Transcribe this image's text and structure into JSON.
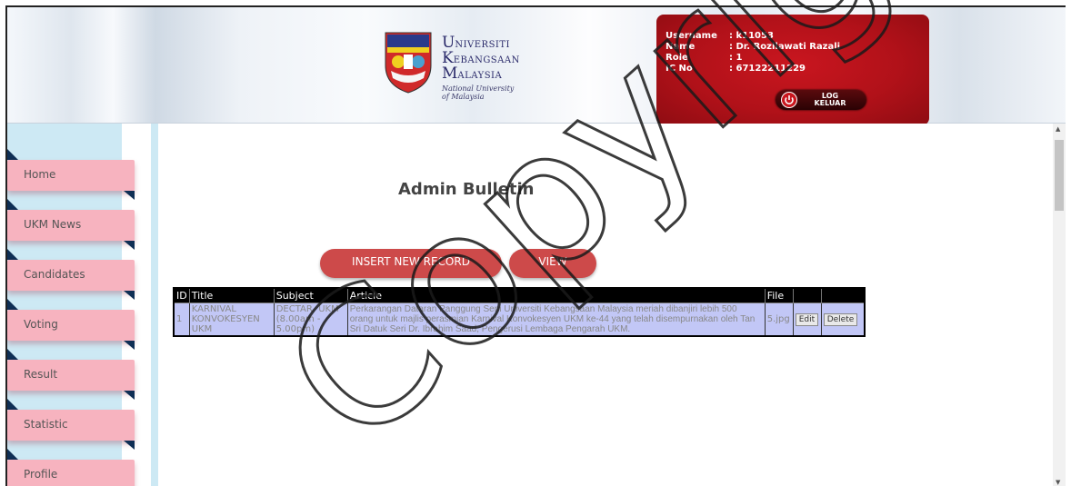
{
  "header": {
    "logo": {
      "name_line1_cap": "U",
      "name_line1_rest": "NIVERSITI",
      "name_line2_cap": "K",
      "name_line2_rest": "EBANGSAAN",
      "name_line3_cap": "M",
      "name_line3_rest": "ALAYSIA",
      "english_line1": "National University",
      "english_line2": "of Malaysia"
    },
    "user": {
      "username_label": "Username",
      "username_value": ": k11053",
      "name_label": "Name",
      "name_value": ": Dr. Rozilawati Razali",
      "role_label": "Role",
      "role_value": ": 1",
      "ic_label": "IC No",
      "ic_value": ": 67122211229"
    },
    "logout_line1": "LOG",
    "logout_line2": "KELUAR"
  },
  "sidebar": {
    "items": [
      {
        "label": "Home"
      },
      {
        "label": "UKM News"
      },
      {
        "label": "Candidates"
      },
      {
        "label": "Voting"
      },
      {
        "label": "Result"
      },
      {
        "label": "Statistic"
      },
      {
        "label": "Profile"
      }
    ]
  },
  "main": {
    "title": "Admin Bulletin",
    "insert_label": "INSERT NEW RECORD",
    "view_label": "VIEW",
    "table": {
      "headers": [
        "ID",
        "Title",
        "Subject",
        "Article",
        "File",
        "",
        ""
      ],
      "rows": [
        {
          "id": "1",
          "title": "KARNIVAL KONVOKESYEN UKM",
          "subject": "DECTAR, UKM (8.00am - 5.00pm)",
          "article": "Perkarangan Dataran Panggung Seni Universiti Kebangsaan Malaysia meriah dibanjiri lebih 500 orang untuk majlis perasmian Karnival Konvokesyen UKM ke-44 yang telah disempurnakan oleh Tan Sri Datuk Seri Dr. Ibrahim Saad, Pengerusi Lembaga Pengarah UKM.",
          "file": "5.jpg",
          "edit_label": "Edit",
          "delete_label": "Delete"
        }
      ]
    }
  },
  "watermark": "Copyright@FTSM",
  "colors": {
    "userbox": "#b11119",
    "nav_item": "#f7b3bf",
    "sidebar_bg": "#cde9f4",
    "button": "#cd4a4a",
    "table_row": "#c2c7f6"
  }
}
